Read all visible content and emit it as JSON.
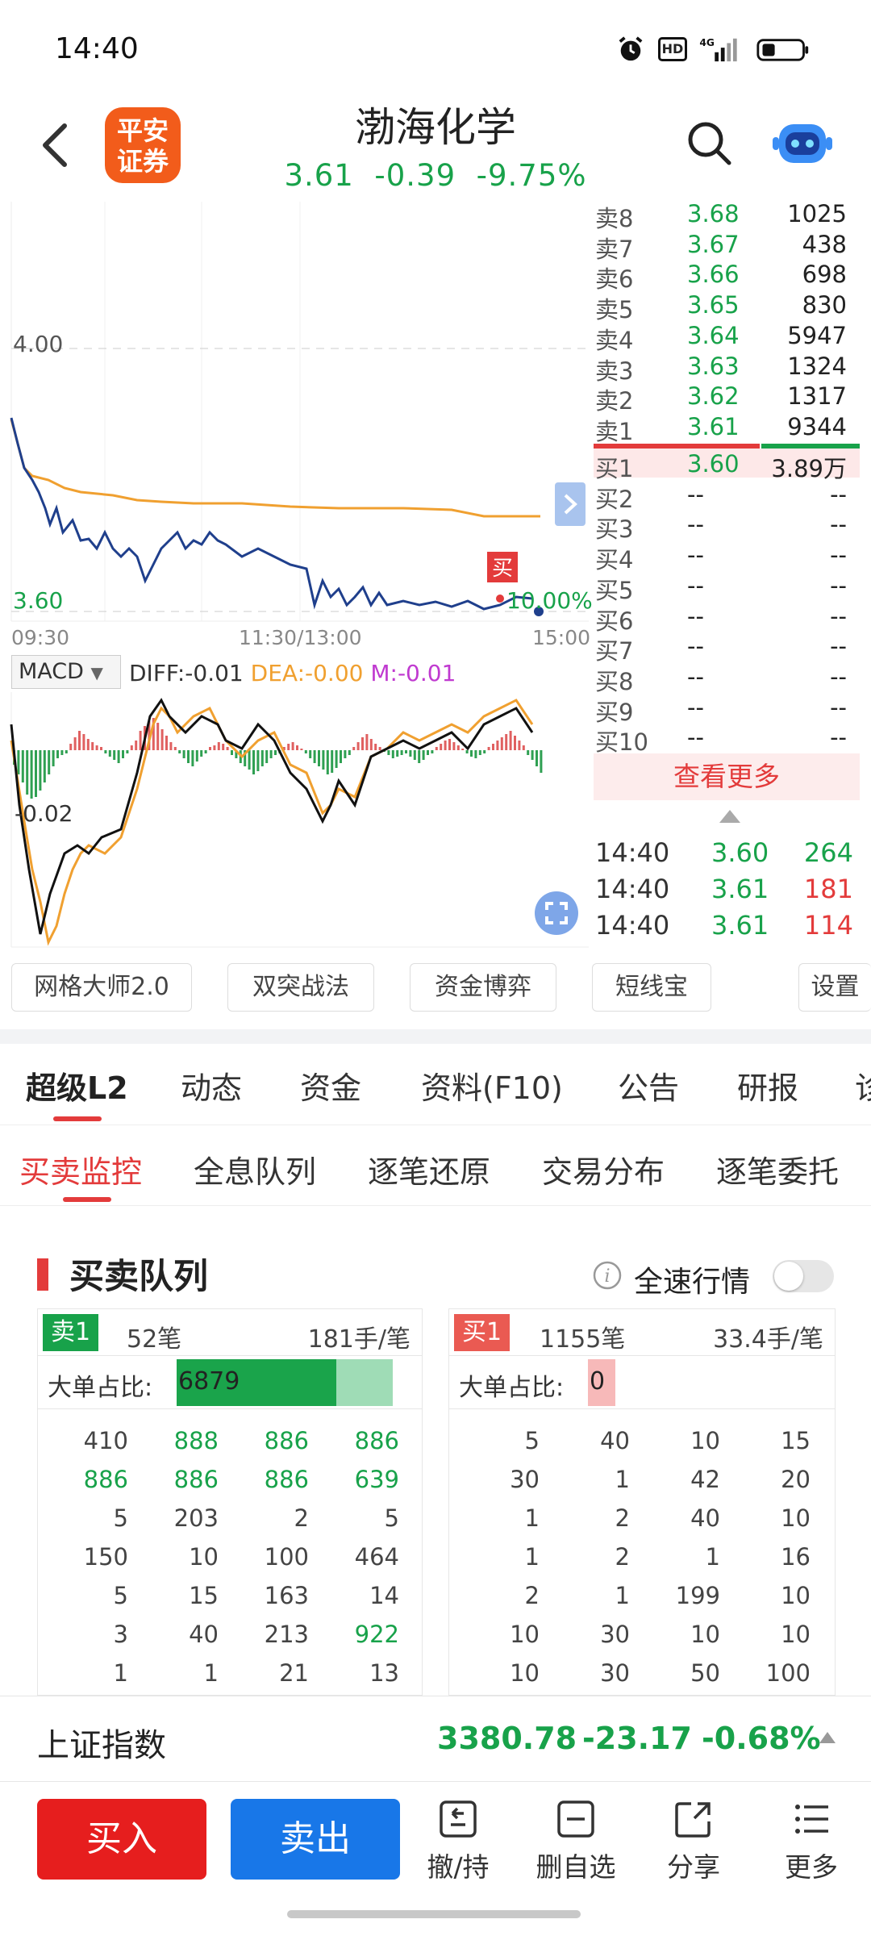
{
  "status": {
    "time": "14:40",
    "network": "4G",
    "hd": "HD"
  },
  "header": {
    "logo": [
      "平安",
      "证券"
    ],
    "name": "渤海化学",
    "price": "3.61",
    "change": "-0.39",
    "change_pct": "-9.75%"
  },
  "chart": {
    "price_high_label": "4.00",
    "price_low_label": "3.60",
    "buy_marker": "买",
    "pct_label": "10.00%",
    "time_labels": [
      "09:30",
      "11:30/13:00",
      "15:00"
    ],
    "macd_label": "MACD",
    "diff": "DIFF:-0.01",
    "dea": "DEA:-0.00",
    "m": "M:-0.01",
    "macd_axis_label": "-0.02"
  },
  "orderbook": {
    "asks": [
      {
        "label": "卖8",
        "price": "3.68",
        "vol": "1025"
      },
      {
        "label": "卖7",
        "price": "3.67",
        "vol": "438"
      },
      {
        "label": "卖6",
        "price": "3.66",
        "vol": "698"
      },
      {
        "label": "卖5",
        "price": "3.65",
        "vol": "830"
      },
      {
        "label": "卖4",
        "price": "3.64",
        "vol": "5947"
      },
      {
        "label": "卖3",
        "price": "3.63",
        "vol": "1324"
      },
      {
        "label": "卖2",
        "price": "3.62",
        "vol": "1317"
      },
      {
        "label": "卖1",
        "price": "3.61",
        "vol": "9344"
      }
    ],
    "bids": [
      {
        "label": "买1",
        "price": "3.60",
        "vol": "3.89万"
      },
      {
        "label": "买2",
        "price": "--",
        "vol": "--"
      },
      {
        "label": "买3",
        "price": "--",
        "vol": "--"
      },
      {
        "label": "买4",
        "price": "--",
        "vol": "--"
      },
      {
        "label": "买5",
        "price": "--",
        "vol": "--"
      },
      {
        "label": "买6",
        "price": "--",
        "vol": "--"
      },
      {
        "label": "买7",
        "price": "--",
        "vol": "--"
      },
      {
        "label": "买8",
        "price": "--",
        "vol": "--"
      },
      {
        "label": "买9",
        "price": "--",
        "vol": "--"
      },
      {
        "label": "买10",
        "price": "--",
        "vol": "--"
      }
    ],
    "more": "查看更多",
    "ticks": [
      {
        "time": "14:40",
        "price": "3.60",
        "vol": "264"
      },
      {
        "time": "14:40",
        "price": "3.61",
        "vol": "181"
      },
      {
        "time": "14:40",
        "price": "3.61",
        "vol": "114"
      }
    ]
  },
  "tools": [
    "网格大师2.0",
    "双突战法",
    "资金博弈",
    "短线宝",
    "设置"
  ],
  "tabs1": [
    "超级L2",
    "动态",
    "资金",
    "资料(F10)",
    "公告",
    "研报",
    "诊"
  ],
  "tabs2": [
    "买卖监控",
    "全息队列",
    "逐笔还原",
    "交易分布",
    "逐笔委托"
  ],
  "queue": {
    "title": "买卖队列",
    "fast_label": "全速行情",
    "big_ratio_label": "大单占比:",
    "sell": {
      "tag": "卖1",
      "count": "52笔",
      "avg": "181手/笔",
      "big": "6879",
      "rows": [
        [
          "410",
          "888",
          "886",
          "886"
        ],
        [
          "886",
          "886",
          "886",
          "639"
        ],
        [
          "5",
          "203",
          "2",
          "5"
        ],
        [
          "150",
          "10",
          "100",
          "464"
        ],
        [
          "5",
          "15",
          "163",
          "14"
        ],
        [
          "3",
          "40",
          "213",
          "922"
        ],
        [
          "1",
          "1",
          "21",
          "13"
        ]
      ]
    },
    "buy": {
      "tag": "买1",
      "count": "1155笔",
      "avg": "33.4手/笔",
      "big": "0",
      "rows": [
        [
          "5",
          "40",
          "10",
          "15"
        ],
        [
          "30",
          "1",
          "42",
          "20"
        ],
        [
          "1",
          "2",
          "40",
          "10"
        ],
        [
          "1",
          "2",
          "1",
          "16"
        ],
        [
          "2",
          "1",
          "199",
          "10"
        ],
        [
          "10",
          "30",
          "10",
          "10"
        ],
        [
          "10",
          "30",
          "50",
          "100"
        ]
      ]
    }
  },
  "index": {
    "name": "上证指数",
    "value": "3380.78",
    "change": "-23.17",
    "pct": "-0.68%"
  },
  "actions": {
    "buy": "买入",
    "sell": "卖出",
    "items": [
      "撤/持",
      "删自选",
      "分享",
      "更多"
    ]
  },
  "colors": {
    "down": "#18a24a",
    "up": "#e33b3b",
    "avg_line": "#f0a030",
    "price_line": "#1f3f8c",
    "sell_btn": "#1877e8",
    "buy_btn": "#e61e1e"
  }
}
